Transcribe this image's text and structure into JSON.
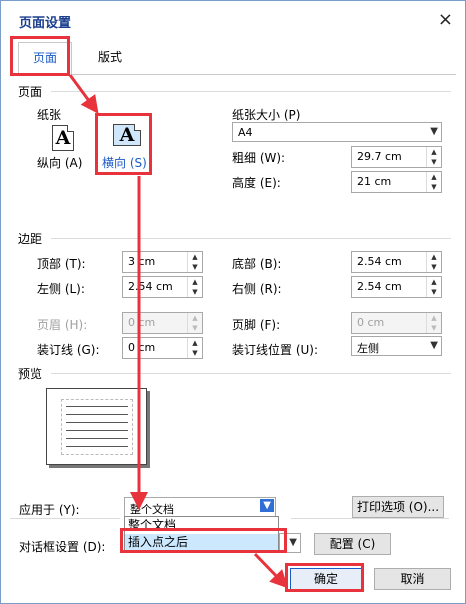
{
  "dialog": {
    "title": "页面设置",
    "close_glyph": "×"
  },
  "tabs": [
    {
      "label": "页面"
    },
    {
      "label": "版式"
    }
  ],
  "page_section": {
    "label": "页面",
    "paper_label": "纸张",
    "portrait_glyph": "A",
    "landscape_glyph": "A",
    "portrait_label": "纵向 (A)",
    "landscape_label": "横向 (S)",
    "paper_size_label": "纸张大小 (P)",
    "paper_size_value": "A4",
    "width_label": "粗细 (W):",
    "width_value": "29.7 cm",
    "height_label": "高度 (E):",
    "height_value": "21 cm"
  },
  "margins": {
    "label": "边距",
    "top_label": "顶部 (T):",
    "top_value": "3 cm",
    "bottom_label": "底部 (B):",
    "bottom_value": "2.54 cm",
    "left_label": "左侧 (L):",
    "left_value": "2.54 cm",
    "right_label": "右侧 (R):",
    "right_value": "2.54 cm",
    "header_label": "页眉 (H):",
    "header_value": "0 cm",
    "footer_label": "页脚 (F):",
    "footer_value": "0 cm",
    "gutter_label": "装订线 (G):",
    "gutter_value": "0 cm",
    "gutter_pos_label": "装订线位置 (U):",
    "gutter_pos_value": "左侧"
  },
  "preview": {
    "label": "预览"
  },
  "apply": {
    "label": "应用于 (Y):",
    "value": "整个文档",
    "options": [
      "整个文档",
      "插入点之后"
    ],
    "print_options_label": "打印选项 (O)..."
  },
  "dialog_settings": {
    "label": "对话框设置 (D):",
    "config_label": "配置 (C)"
  },
  "footer": {
    "ok_label": "确定",
    "cancel_label": "取消"
  },
  "colors": {
    "highlight": "#e8333c",
    "accent": "#1a5ac8"
  }
}
